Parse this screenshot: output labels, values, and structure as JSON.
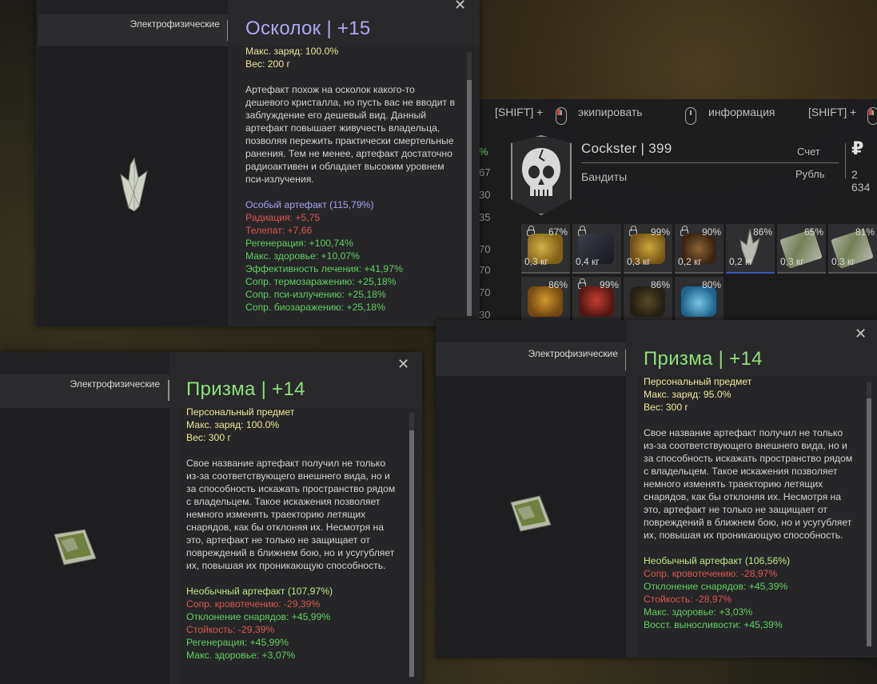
{
  "inventory": {
    "hints": [
      {
        "prefix": "[SHIFT] +",
        "action": "экипировать"
      },
      {
        "action": "информация"
      },
      {
        "prefix": "[SHIFT] +"
      }
    ],
    "player_name": "Cockster | 399",
    "faction": "Бандиты",
    "account_label": "Счет",
    "currency_label": "Рубль",
    "money": "2 634",
    "currency_symbol": "₽",
    "left_strip": [
      "%",
      "67",
      "30",
      "35",
      "70",
      "70",
      "70",
      "30"
    ],
    "slots_row1": [
      {
        "pct": "67%",
        "weight": "0,3 кг",
        "color": "#c79a2a",
        "locked": true
      },
      {
        "pct": "",
        "weight": "0,4 кг",
        "color": "#2d3340",
        "locked": true
      },
      {
        "pct": "99%",
        "weight": "0,3 кг",
        "color": "#b8902a",
        "locked": true
      },
      {
        "pct": "90%",
        "weight": "0,2 кг",
        "color": "#7a4c22",
        "locked": true
      },
      {
        "pct": "86%",
        "weight": "0,2 кг",
        "color": "#c8cbbd",
        "locked": false,
        "selected": true
      },
      {
        "pct": "65%",
        "weight": "0,3 кг",
        "color": "#7b8a5a",
        "locked": false
      },
      {
        "pct": "81%",
        "weight": "0,3 кг",
        "color": "#7b8a5a",
        "locked": false
      }
    ],
    "slots_row2": [
      {
        "pct": "86%",
        "color": "#c8871e",
        "locked": false
      },
      {
        "pct": "99%",
        "color": "#9e2a22",
        "locked": true
      },
      {
        "pct": "86%",
        "color": "#3e3520",
        "locked": false
      },
      {
        "pct": "80%",
        "color": "#3aa8d8",
        "locked": false
      }
    ]
  },
  "win1": {
    "category": "Электрофизические",
    "title": "Осколок | +15",
    "title_color": "#b0a8f5",
    "close": "✕",
    "lines_top": [
      "Макс. заряд: 100.0%",
      "Вес: 200 г"
    ],
    "description": "Артефакт похож на осколок какого-то дешевого кристалла, но пусть вас не вводит в заблуждение его дешевый вид. Данный артефакт повышает живучесть владельца, позволяя пережить практически смертельные ранения. Тем не менее, артефакт достаточно радиоактивен и обладает высоким уровнем пси-излучения.",
    "rarity": "Особый артефакт (115,79%)",
    "stats": [
      {
        "text": "Радиация: +5,75",
        "kind": "bad"
      },
      {
        "text": "Телепат: +7,66",
        "kind": "bad"
      },
      {
        "text": "Регенерация: +100,74%",
        "kind": "good"
      },
      {
        "text": "Макс. здоровье: +10,07%",
        "kind": "good"
      },
      {
        "text": "Эффективность лечения: +41,97%",
        "kind": "good"
      },
      {
        "text": "Сопр. термозаражению: +25,18%",
        "kind": "good"
      },
      {
        "text": "Сопр. пси-излучению: +25,18%",
        "kind": "good"
      },
      {
        "text": "Сопр. биозаражению: +25,18%",
        "kind": "good"
      }
    ]
  },
  "win2": {
    "category": "Электрофизические",
    "title": "Призма | +14",
    "title_color": "#8fe07a",
    "close": "✕",
    "lines_top": [
      "Персональный предмет",
      "Макс. заряд: 100.0%",
      "Вес: 300 г"
    ],
    "description": "Свое название артефакт получил не только из-за соответствующего внешнего вида, но и за способность искажать пространство рядом с владельцем. Такое искажения позволяет немного изменять траекторию летящих снарядов, как бы отклоняя их. Несмотря на это, артефакт не только не защищает от повреждений в ближнем бою, но и усугубляет их, повышая их проникающую способность.",
    "rarity": "Необычный артефакт (107,97%)",
    "stats": [
      {
        "text": "Сопр. кровотечению: -29,39%",
        "kind": "bad"
      },
      {
        "text": "Отклонение снарядов: +45,99%",
        "kind": "good"
      },
      {
        "text": "Стойкость: -29,39%",
        "kind": "bad"
      },
      {
        "text": "Регенерация: +45,99%",
        "kind": "good"
      },
      {
        "text": "Макс. здоровье: +3,07%",
        "kind": "good"
      }
    ]
  },
  "win3": {
    "category": "Электрофизические",
    "title": "Призма | +14",
    "title_color": "#8fe07a",
    "close": "✕",
    "lines_top": [
      "Персональный предмет",
      "Макс. заряд: 95.0%",
      "Вес: 300 г"
    ],
    "description": "Свое название артефакт получил не только из-за соответствующего внешнего вида, но и за способность искажать пространство рядом с владельцем. Такое искажения позволяет немного изменять траекторию летящих снарядов, как бы отклоняя их. Несмотря на это, артефакт не только не защищает от повреждений в ближнем бою, но и усугубляет их, повышая их проникающую способность.",
    "rarity": "Необычный артефакт (106,56%)",
    "stats": [
      {
        "text": "Сопр. кровотечению: -28,97%",
        "kind": "bad"
      },
      {
        "text": "Отклонение снарядов: +45,39%",
        "kind": "good"
      },
      {
        "text": "Стойкость: -28,97%",
        "kind": "bad"
      },
      {
        "text": "Макс. здоровье: +3,03%",
        "kind": "good"
      },
      {
        "text": "Восст. выносливости: +45,39%",
        "kind": "good"
      }
    ]
  },
  "colors": {
    "good": "#62cf64",
    "bad": "#d9574f",
    "rarity_special": "#a8a2ef",
    "rarity_uncommon": "#bfe58a",
    "stat_yellow": "#eee69a"
  }
}
